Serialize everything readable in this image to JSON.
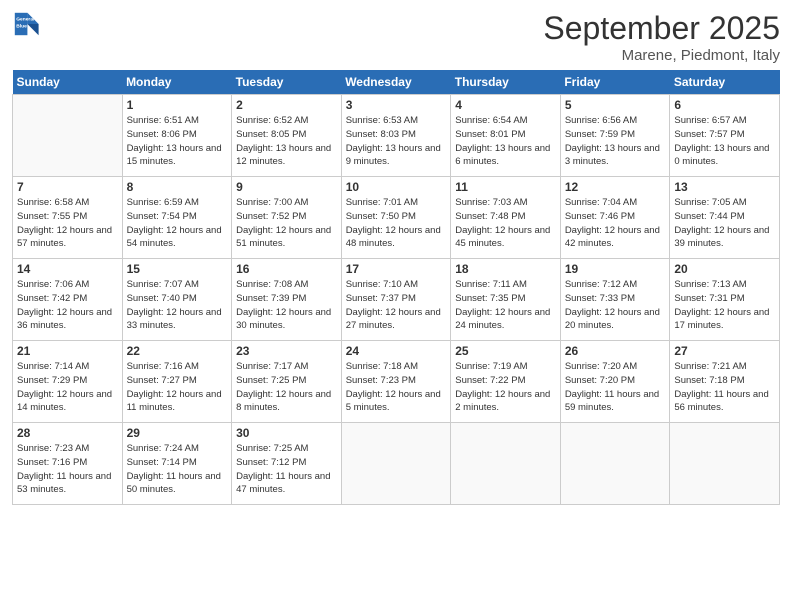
{
  "header": {
    "logo_line1": "General",
    "logo_line2": "Blue",
    "month": "September 2025",
    "location": "Marene, Piedmont, Italy"
  },
  "weekdays": [
    "Sunday",
    "Monday",
    "Tuesday",
    "Wednesday",
    "Thursday",
    "Friday",
    "Saturday"
  ],
  "weeks": [
    [
      {
        "day": "",
        "sunrise": "",
        "sunset": "",
        "daylight": ""
      },
      {
        "day": "1",
        "sunrise": "Sunrise: 6:51 AM",
        "sunset": "Sunset: 8:06 PM",
        "daylight": "Daylight: 13 hours and 15 minutes."
      },
      {
        "day": "2",
        "sunrise": "Sunrise: 6:52 AM",
        "sunset": "Sunset: 8:05 PM",
        "daylight": "Daylight: 13 hours and 12 minutes."
      },
      {
        "day": "3",
        "sunrise": "Sunrise: 6:53 AM",
        "sunset": "Sunset: 8:03 PM",
        "daylight": "Daylight: 13 hours and 9 minutes."
      },
      {
        "day": "4",
        "sunrise": "Sunrise: 6:54 AM",
        "sunset": "Sunset: 8:01 PM",
        "daylight": "Daylight: 13 hours and 6 minutes."
      },
      {
        "day": "5",
        "sunrise": "Sunrise: 6:56 AM",
        "sunset": "Sunset: 7:59 PM",
        "daylight": "Daylight: 13 hours and 3 minutes."
      },
      {
        "day": "6",
        "sunrise": "Sunrise: 6:57 AM",
        "sunset": "Sunset: 7:57 PM",
        "daylight": "Daylight: 13 hours and 0 minutes."
      }
    ],
    [
      {
        "day": "7",
        "sunrise": "Sunrise: 6:58 AM",
        "sunset": "Sunset: 7:55 PM",
        "daylight": "Daylight: 12 hours and 57 minutes."
      },
      {
        "day": "8",
        "sunrise": "Sunrise: 6:59 AM",
        "sunset": "Sunset: 7:54 PM",
        "daylight": "Daylight: 12 hours and 54 minutes."
      },
      {
        "day": "9",
        "sunrise": "Sunrise: 7:00 AM",
        "sunset": "Sunset: 7:52 PM",
        "daylight": "Daylight: 12 hours and 51 minutes."
      },
      {
        "day": "10",
        "sunrise": "Sunrise: 7:01 AM",
        "sunset": "Sunset: 7:50 PM",
        "daylight": "Daylight: 12 hours and 48 minutes."
      },
      {
        "day": "11",
        "sunrise": "Sunrise: 7:03 AM",
        "sunset": "Sunset: 7:48 PM",
        "daylight": "Daylight: 12 hours and 45 minutes."
      },
      {
        "day": "12",
        "sunrise": "Sunrise: 7:04 AM",
        "sunset": "Sunset: 7:46 PM",
        "daylight": "Daylight: 12 hours and 42 minutes."
      },
      {
        "day": "13",
        "sunrise": "Sunrise: 7:05 AM",
        "sunset": "Sunset: 7:44 PM",
        "daylight": "Daylight: 12 hours and 39 minutes."
      }
    ],
    [
      {
        "day": "14",
        "sunrise": "Sunrise: 7:06 AM",
        "sunset": "Sunset: 7:42 PM",
        "daylight": "Daylight: 12 hours and 36 minutes."
      },
      {
        "day": "15",
        "sunrise": "Sunrise: 7:07 AM",
        "sunset": "Sunset: 7:40 PM",
        "daylight": "Daylight: 12 hours and 33 minutes."
      },
      {
        "day": "16",
        "sunrise": "Sunrise: 7:08 AM",
        "sunset": "Sunset: 7:39 PM",
        "daylight": "Daylight: 12 hours and 30 minutes."
      },
      {
        "day": "17",
        "sunrise": "Sunrise: 7:10 AM",
        "sunset": "Sunset: 7:37 PM",
        "daylight": "Daylight: 12 hours and 27 minutes."
      },
      {
        "day": "18",
        "sunrise": "Sunrise: 7:11 AM",
        "sunset": "Sunset: 7:35 PM",
        "daylight": "Daylight: 12 hours and 24 minutes."
      },
      {
        "day": "19",
        "sunrise": "Sunrise: 7:12 AM",
        "sunset": "Sunset: 7:33 PM",
        "daylight": "Daylight: 12 hours and 20 minutes."
      },
      {
        "day": "20",
        "sunrise": "Sunrise: 7:13 AM",
        "sunset": "Sunset: 7:31 PM",
        "daylight": "Daylight: 12 hours and 17 minutes."
      }
    ],
    [
      {
        "day": "21",
        "sunrise": "Sunrise: 7:14 AM",
        "sunset": "Sunset: 7:29 PM",
        "daylight": "Daylight: 12 hours and 14 minutes."
      },
      {
        "day": "22",
        "sunrise": "Sunrise: 7:16 AM",
        "sunset": "Sunset: 7:27 PM",
        "daylight": "Daylight: 12 hours and 11 minutes."
      },
      {
        "day": "23",
        "sunrise": "Sunrise: 7:17 AM",
        "sunset": "Sunset: 7:25 PM",
        "daylight": "Daylight: 12 hours and 8 minutes."
      },
      {
        "day": "24",
        "sunrise": "Sunrise: 7:18 AM",
        "sunset": "Sunset: 7:23 PM",
        "daylight": "Daylight: 12 hours and 5 minutes."
      },
      {
        "day": "25",
        "sunrise": "Sunrise: 7:19 AM",
        "sunset": "Sunset: 7:22 PM",
        "daylight": "Daylight: 12 hours and 2 minutes."
      },
      {
        "day": "26",
        "sunrise": "Sunrise: 7:20 AM",
        "sunset": "Sunset: 7:20 PM",
        "daylight": "Daylight: 11 hours and 59 minutes."
      },
      {
        "day": "27",
        "sunrise": "Sunrise: 7:21 AM",
        "sunset": "Sunset: 7:18 PM",
        "daylight": "Daylight: 11 hours and 56 minutes."
      }
    ],
    [
      {
        "day": "28",
        "sunrise": "Sunrise: 7:23 AM",
        "sunset": "Sunset: 7:16 PM",
        "daylight": "Daylight: 11 hours and 53 minutes."
      },
      {
        "day": "29",
        "sunrise": "Sunrise: 7:24 AM",
        "sunset": "Sunset: 7:14 PM",
        "daylight": "Daylight: 11 hours and 50 minutes."
      },
      {
        "day": "30",
        "sunrise": "Sunrise: 7:25 AM",
        "sunset": "Sunset: 7:12 PM",
        "daylight": "Daylight: 11 hours and 47 minutes."
      },
      {
        "day": "",
        "sunrise": "",
        "sunset": "",
        "daylight": ""
      },
      {
        "day": "",
        "sunrise": "",
        "sunset": "",
        "daylight": ""
      },
      {
        "day": "",
        "sunrise": "",
        "sunset": "",
        "daylight": ""
      },
      {
        "day": "",
        "sunrise": "",
        "sunset": "",
        "daylight": ""
      }
    ]
  ]
}
